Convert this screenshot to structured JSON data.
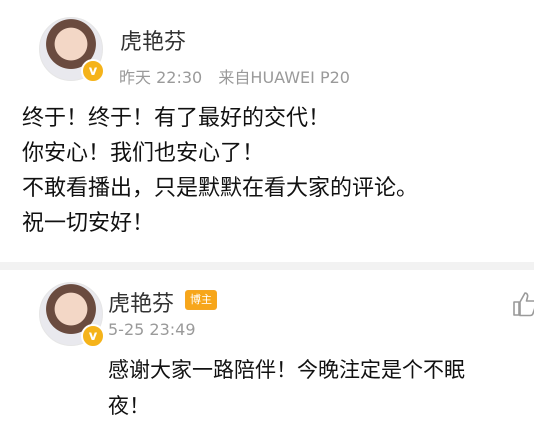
{
  "post": {
    "author": "虎艳芬",
    "time": "昨天 22:30",
    "source_prefix": "来自",
    "source": "HUAWEI P20",
    "lines": [
      "终于！终于！有了最好的交代！",
      "你安心！我们也安心了！",
      "不敢看播出，只是默默在看大家的评论。",
      "祝一切安好！"
    ]
  },
  "comment": {
    "author": "虎艳芬",
    "badge": "博主",
    "time": "5-25 23:49",
    "lines": [
      "感谢大家一路陪伴！今晚注定是个不眠",
      "夜！"
    ]
  },
  "icons": {
    "verified": "verified-icon",
    "like": "thumbs-up-icon"
  },
  "colors": {
    "verified_badge": "#f5b31a",
    "meta_gray": "#9a9a9a",
    "blogger_badge": "#f7a61a"
  }
}
